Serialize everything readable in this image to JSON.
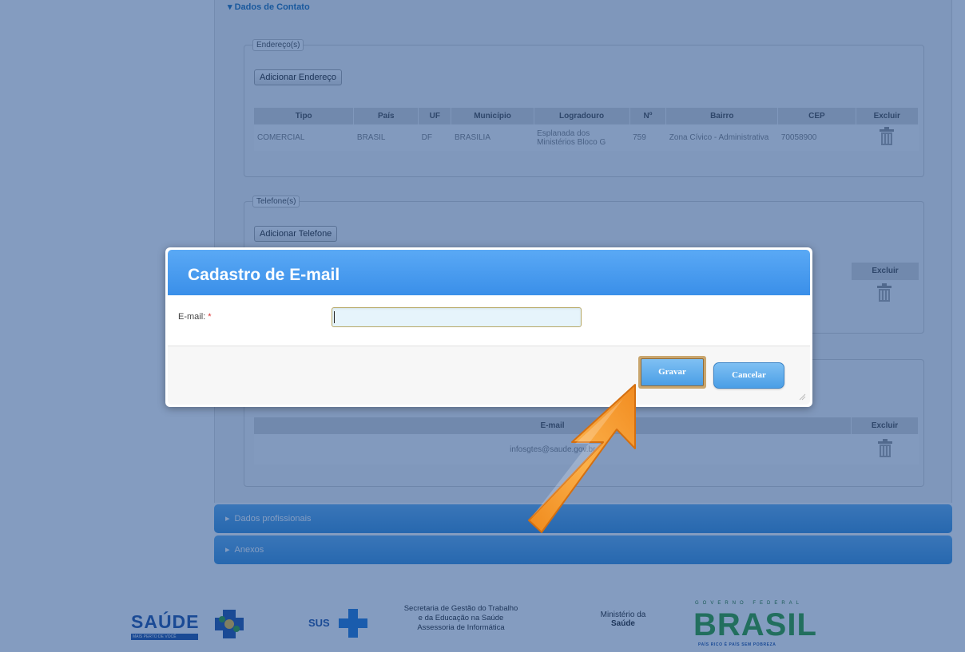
{
  "contact_section": {
    "title": "Dados de Contato"
  },
  "address": {
    "legend": "Endereço(s)",
    "add_button": "Adicionar Endereço",
    "columns": [
      "Tipo",
      "País",
      "UF",
      "Município",
      "Logradouro",
      "Nº",
      "Bairro",
      "CEP",
      "Excluir"
    ],
    "rows": [
      {
        "tipo": "COMERCIAL",
        "pais": "BRASIL",
        "uf": "DF",
        "municipio": "BRASILIA",
        "logradouro": "Esplanada dos Ministérios Bloco G",
        "numero": "759",
        "bairro": "Zona Cívico - Administrativa",
        "cep": "70058900"
      }
    ]
  },
  "phone": {
    "legend": "Telefone(s)",
    "add_button": "Adicionar Telefone",
    "delete_header": "Excluir"
  },
  "email_table": {
    "column_email": "E-mail",
    "column_delete": "Excluir",
    "rows": [
      {
        "email": "infosgtes@saude.gov.br"
      }
    ]
  },
  "accordions": [
    {
      "label": "Dados profissionais"
    },
    {
      "label": "Anexos"
    }
  ],
  "footer": {
    "saude_logo": "SAÚDE",
    "saude_tagline": "MAIS PERTO DE VOCÊ",
    "sus_logo": "SUS",
    "secretaria_line1": "Secretaria de Gestão do Trabalho",
    "secretaria_line2": "e da Educação na Saúde",
    "secretaria_line3": "Assessoria de Informática",
    "ministerio_line1": "Ministério da",
    "ministerio_line2": "Saúde",
    "brasil_top": "GOVERNO FEDERAL",
    "brasil_logo": "BRASIL",
    "brasil_slogan": "PAÍS RICO É PAÍS SEM POBREZA"
  },
  "dialog": {
    "title": "Cadastro de E-mail",
    "email_label": "E-mail:",
    "required_marker": "*",
    "email_value": "",
    "save_button": "Gravar",
    "cancel_button": "Cancelar"
  },
  "colors": {
    "dialog_title": "#4a9ae8",
    "overlay": "#0a3a82",
    "accordion": "#4496dc",
    "arrow": "#f5a030"
  },
  "icons": [
    "trash-icon",
    "chevron-right-icon",
    "resize-grip-icon",
    "pointer-arrow-icon"
  ]
}
